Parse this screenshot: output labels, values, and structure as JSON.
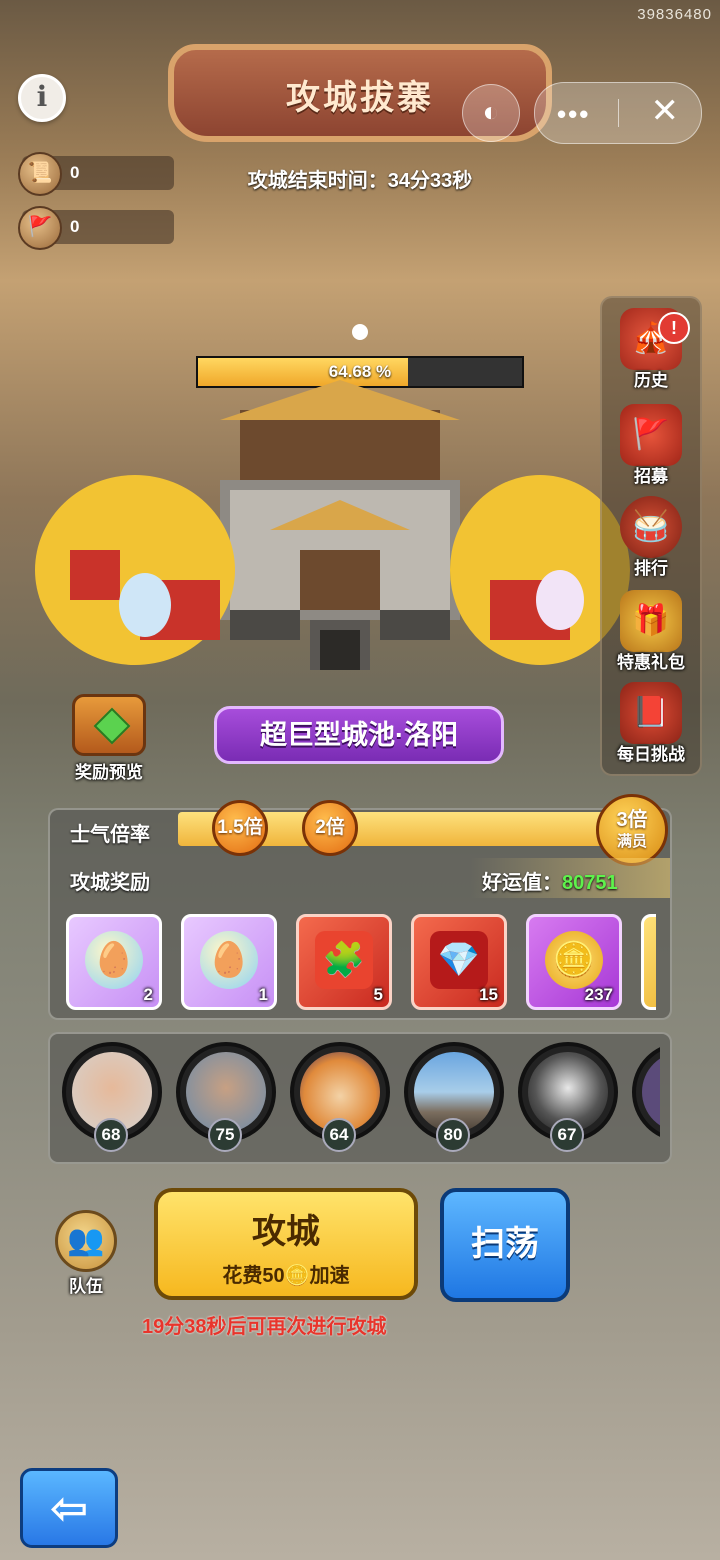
{
  "corner_id": "39836480",
  "header": {
    "title": "攻城拔寨",
    "timer": "攻城结束时间：34分33秒",
    "info_icon": "i",
    "more_icon": "•••",
    "close_icon": "✕",
    "game_icon": "◐"
  },
  "resources": [
    {
      "icon": "scroll-icon",
      "value": "0"
    },
    {
      "icon": "flag-icon",
      "value": "0"
    }
  ],
  "siege": {
    "progress_label": "64.68 %",
    "progress_fraction": 0.6468
  },
  "side_menu": [
    {
      "label": "历史",
      "icon": "history-icon",
      "alert": "!"
    },
    {
      "label": "招募",
      "icon": "recruit-icon"
    },
    {
      "label": "排行",
      "icon": "ranking-icon"
    },
    {
      "label": "特惠礼包",
      "icon": "gift-pack-icon"
    },
    {
      "label": "每日挑战",
      "icon": "daily-challenge-icon"
    }
  ],
  "reward_preview": {
    "label": "奖励预览"
  },
  "city": {
    "name": "超巨型城池·洛阳"
  },
  "morale": {
    "label": "士气倍率",
    "multipliers": [
      "1.5倍",
      "2倍"
    ],
    "max_label": "3倍",
    "max_sub": "满员"
  },
  "rewards": {
    "label": "攻城奖励",
    "luck_label": "好运值：",
    "luck_value": "80751",
    "items": [
      {
        "icon": "rainbow-egg-icon",
        "count": "2"
      },
      {
        "icon": "rainbow-egg-icon",
        "count": "1"
      },
      {
        "icon": "puzzle-piece-icon",
        "count": "5"
      },
      {
        "icon": "red-crystal-icon",
        "count": "15"
      },
      {
        "icon": "gold-ingot-icon",
        "count": "237"
      }
    ]
  },
  "team_members": [
    {
      "level": "68"
    },
    {
      "level": "75"
    },
    {
      "level": "64"
    },
    {
      "level": "80"
    },
    {
      "level": "67"
    }
  ],
  "actions": {
    "team_label": "队伍",
    "attack_label": "攻城",
    "attack_cost": "花费50",
    "attack_speed": "加速",
    "sweep_label": "扫荡",
    "cooldown": "19分38秒后可再次进行攻城"
  },
  "colors": {
    "progress_fill": "#f0a82a",
    "luck_value": "#5ef24c",
    "cooldown": "#e8352c",
    "city_banner": "#8a35c4"
  }
}
